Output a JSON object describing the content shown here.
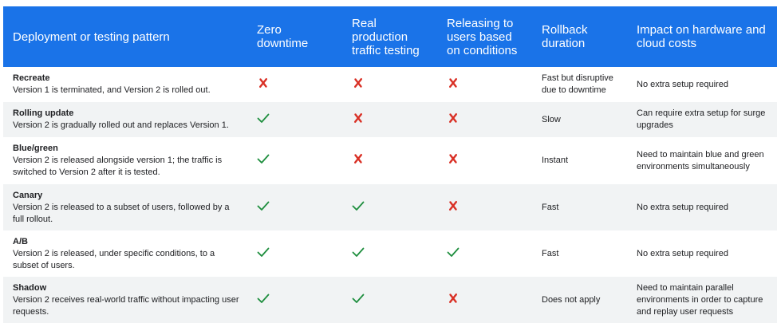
{
  "headers": [
    "Deployment or testing pattern",
    "Zero downtime",
    "Real production traffic testing",
    "Releasing to users based on conditions",
    "Rollback duration",
    "Impact on hardware and cloud costs"
  ],
  "rows": [
    {
      "name": "Recreate",
      "desc": "Version 1 is terminated, and Version 2 is rolled out.",
      "zero_downtime": "cross-icon",
      "real_traffic": "cross-icon",
      "conditions": "cross-icon",
      "rollback": "Fast but disruptive due to downtime",
      "cost": "No extra setup required"
    },
    {
      "name": "Rolling update",
      "desc": "Version 2 is gradually rolled out and replaces Version 1.",
      "zero_downtime": "check-icon",
      "real_traffic": "cross-icon",
      "conditions": "cross-icon",
      "rollback": "Slow",
      "cost": "Can require extra setup for surge upgrades"
    },
    {
      "name": "Blue/green",
      "desc": "Version 2 is released alongside version 1; the traffic is switched to Version 2 after it is tested.",
      "zero_downtime": "check-icon",
      "real_traffic": "cross-icon",
      "conditions": "cross-icon",
      "rollback": "Instant",
      "cost": "Need to maintain blue and green environments simultaneously"
    },
    {
      "name": "Canary",
      "desc": "Version 2 is released to a subset of users, followed by a full rollout.",
      "zero_downtime": "check-icon",
      "real_traffic": "check-icon",
      "conditions": "cross-icon",
      "rollback": "Fast",
      "cost": "No extra setup required"
    },
    {
      "name": "A/B",
      "desc": "Version 2 is released, under specific conditions, to a subset of users.",
      "zero_downtime": "check-icon",
      "real_traffic": "check-icon",
      "conditions": "check-icon",
      "rollback": "Fast",
      "cost": "No extra setup required"
    },
    {
      "name": "Shadow",
      "desc": "Version 2 receives real-world traffic without impacting user requests.",
      "zero_downtime": "check-icon",
      "real_traffic": "check-icon",
      "conditions": "cross-icon",
      "rollback": "Does not apply",
      "cost": "Need to maintain parallel environments in order to capture and replay user requests"
    }
  ],
  "colors": {
    "header_bg": "#1a73e8",
    "check": "#1e8e3e",
    "cross": "#d93025",
    "stripe": "#f1f3f4"
  }
}
